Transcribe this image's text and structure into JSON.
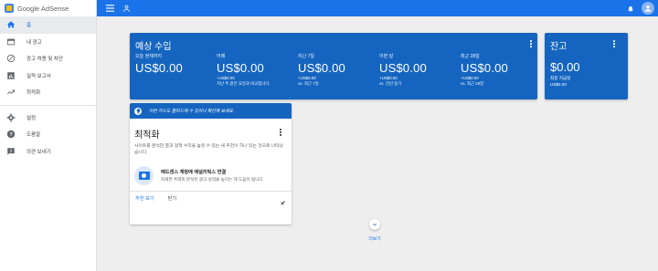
{
  "app": {
    "logo_text": "Google AdSense"
  },
  "sidebar": {
    "items": [
      {
        "label": "홈",
        "icon": "home-icon",
        "active": true
      },
      {
        "label": "내 광고",
        "icon": "ads-icon"
      },
      {
        "label": "광고 허용 및 차단",
        "icon": "block-icon"
      },
      {
        "label": "실적 보고서",
        "icon": "report-icon"
      },
      {
        "label": "최적화",
        "icon": "trending-icon"
      }
    ],
    "items2": [
      {
        "label": "설정",
        "icon": "gear-icon"
      },
      {
        "label": "도움말",
        "icon": "help-icon"
      },
      {
        "label": "의견 보내기",
        "icon": "feedback-icon"
      }
    ]
  },
  "earnings": {
    "title": "예상 수입",
    "metrics": [
      {
        "label": "오늘 현재까지",
        "value": "US$0.00",
        "sub1": "",
        "sub2": ""
      },
      {
        "label": "어제",
        "value": "US$0.00",
        "sub1": "+US$0.00",
        "sub2": "지난 주 같은 요일과 비교합니다."
      },
      {
        "label": "지난 7일",
        "value": "US$0.00",
        "sub1": "+US$0.00",
        "sub2": "vs. 최근 7일"
      },
      {
        "label": "이번 달",
        "value": "US$0.00",
        "sub1": "+US$0.00",
        "sub2": "vs. 전년 동기"
      },
      {
        "label": "최근 28일",
        "value": "US$0.00",
        "sub1": "+US$0.00",
        "sub2": "vs. 최근 28일"
      }
    ]
  },
  "balance": {
    "title": "잔고",
    "value": "$0.00",
    "sub1": "최종 지급일",
    "sub2": "US$0.00"
  },
  "optimization": {
    "banner": "이런 카드도 홈피드에 수 있어나 확인해 보세요.",
    "title": "최적화",
    "description": "사이트를 분석한 결과 정책 수익을 높힐 수 있는 새 추천이 하나 있는 것으로 나타났습니다.",
    "item_title": "애드센스 계정에 애널리틱스 연결",
    "item_desc": "자세한 트래픽 분석은 광고 실적을 높이는 데 도움이 됩니다.",
    "primary_action": "추천 보기",
    "secondary_action": "닫기"
  },
  "more": {
    "label": "더보기"
  },
  "colors": {
    "brand": "#1a73e8",
    "card": "#1565c0"
  }
}
